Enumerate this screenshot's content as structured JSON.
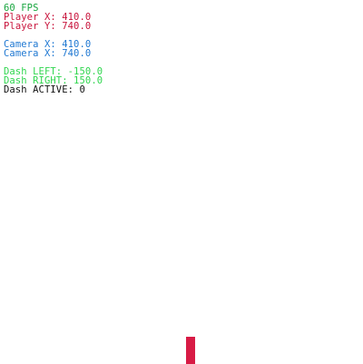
{
  "hud": {
    "fps": {
      "text": "60 FPS",
      "color": "#1aa640"
    },
    "player_x": {
      "text": "Player X: 410.0",
      "color": "#c8143c"
    },
    "player_y": {
      "text": "Player Y: 740.0",
      "color": "#c8143c"
    },
    "camera_x": {
      "text": "Camera X: 410.0",
      "color": "#1f78d2"
    },
    "camera_y": {
      "text": "Camera X: 740.0",
      "color": "#1f78d2"
    },
    "dash_left": {
      "text": "Dash LEFT: -150.0",
      "color": "#2fd64e"
    },
    "dash_right": {
      "text": "Dash RIGHT: 150.0",
      "color": "#2fd64e"
    },
    "dash_active": {
      "text": "Dash ACTIVE: 0",
      "color": "#111111"
    }
  },
  "player": {
    "color": "#d81b45"
  }
}
